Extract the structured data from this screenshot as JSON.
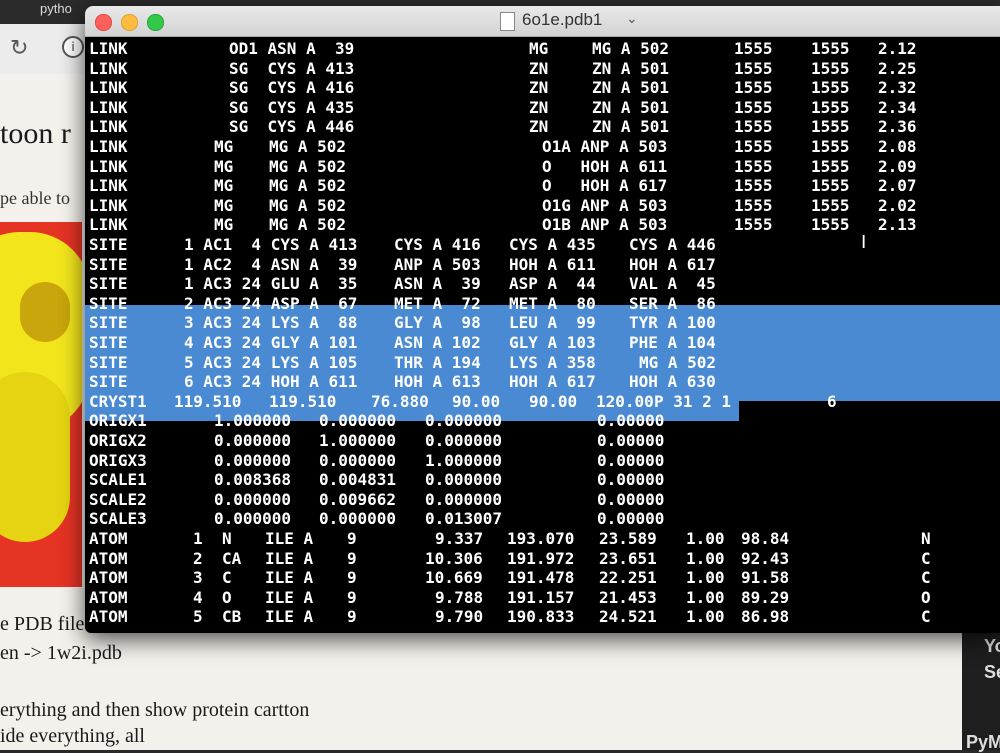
{
  "browser": {
    "tab_label": "pytho",
    "heading_fragment": "toon r",
    "text_lines": [
      "pe able to",
      "e PDB file",
      "en -> 1w2i.pdb",
      "erything and then show protein cartton",
      "ide everything, all"
    ],
    "side_panel_text": [
      "Yo",
      "Se",
      "PyM"
    ]
  },
  "terminal": {
    "title": "6o1e.pdb1",
    "accent_color": "#4a8ad2",
    "selected_rows": [
      12,
      13,
      14,
      15,
      16,
      17
    ],
    "records": [
      {
        "r": "LINK",
        "c": [
          [
            "OD1 ASN A  39",
            140
          ],
          [
            "MG",
            440
          ],
          [
            "MG A 502",
            503
          ],
          [
            "1555",
            645
          ],
          [
            "1555",
            722
          ],
          [
            "2.12",
            789
          ]
        ]
      },
      {
        "r": "LINK",
        "c": [
          [
            "SG  CYS A 413",
            140
          ],
          [
            "ZN",
            440
          ],
          [
            "ZN A 501",
            503
          ],
          [
            "1555",
            645
          ],
          [
            "1555",
            722
          ],
          [
            "2.25",
            789
          ]
        ]
      },
      {
        "r": "LINK",
        "c": [
          [
            "SG  CYS A 416",
            140
          ],
          [
            "ZN",
            440
          ],
          [
            "ZN A 501",
            503
          ],
          [
            "1555",
            645
          ],
          [
            "1555",
            722
          ],
          [
            "2.32",
            789
          ]
        ]
      },
      {
        "r": "LINK",
        "c": [
          [
            "SG  CYS A 435",
            140
          ],
          [
            "ZN",
            440
          ],
          [
            "ZN A 501",
            503
          ],
          [
            "1555",
            645
          ],
          [
            "1555",
            722
          ],
          [
            "2.34",
            789
          ]
        ]
      },
      {
        "r": "LINK",
        "c": [
          [
            "SG  CYS A 446",
            140
          ],
          [
            "ZN",
            440
          ],
          [
            "ZN A 501",
            503
          ],
          [
            "1555",
            645
          ],
          [
            "1555",
            722
          ],
          [
            "2.36",
            789
          ]
        ]
      },
      {
        "r": "LINK",
        "c": [
          [
            "MG",
            125
          ],
          [
            "MG A 502",
            180
          ],
          [
            "O1A ANP A 503",
            453
          ],
          [
            "1555",
            645
          ],
          [
            "1555",
            722
          ],
          [
            "2.08",
            789
          ]
        ]
      },
      {
        "r": "LINK",
        "c": [
          [
            "MG",
            125
          ],
          [
            "MG A 502",
            180
          ],
          [
            "O   HOH A 611",
            453
          ],
          [
            "1555",
            645
          ],
          [
            "1555",
            722
          ],
          [
            "2.09",
            789
          ]
        ]
      },
      {
        "r": "LINK",
        "c": [
          [
            "MG",
            125
          ],
          [
            "MG A 502",
            180
          ],
          [
            "O   HOH A 617",
            453
          ],
          [
            "1555",
            645
          ],
          [
            "1555",
            722
          ],
          [
            "2.07",
            789
          ]
        ]
      },
      {
        "r": "LINK",
        "c": [
          [
            "MG",
            125
          ],
          [
            "MG A 502",
            180
          ],
          [
            "O1G ANP A 503",
            453
          ],
          [
            "1555",
            645
          ],
          [
            "1555",
            722
          ],
          [
            "2.02",
            789
          ]
        ]
      },
      {
        "r": "LINK",
        "c": [
          [
            "MG",
            125
          ],
          [
            "MG A 502",
            180
          ],
          [
            "O1B ANP A 503",
            453
          ],
          [
            "1555",
            645
          ],
          [
            "1555",
            722
          ],
          [
            "2.13",
            789
          ]
        ]
      },
      {
        "r": "SITE",
        "c": [
          [
            "1 AC1  4 CYS A 413",
            95
          ],
          [
            "CYS A 416",
            305
          ],
          [
            "CYS A 435",
            420
          ],
          [
            "CYS A 446",
            540
          ]
        ]
      },
      {
        "r": "SITE",
        "c": [
          [
            "1 AC2  4 ASN A  39",
            95
          ],
          [
            "ANP A 503",
            305
          ],
          [
            "HOH A 611",
            420
          ],
          [
            "HOH A 617",
            540
          ]
        ]
      },
      {
        "r": "SITE",
        "c": [
          [
            "1 AC3 24 GLU A  35",
            95
          ],
          [
            "ASN A  39",
            305
          ],
          [
            "ASP A  44",
            420
          ],
          [
            "VAL A  45",
            540
          ]
        ]
      },
      {
        "r": "SITE",
        "c": [
          [
            "2 AC3 24 ASP A  67",
            95
          ],
          [
            "MET A  72",
            305
          ],
          [
            "MET A  80",
            420
          ],
          [
            "SER A  86",
            540
          ]
        ]
      },
      {
        "r": "SITE",
        "c": [
          [
            "3 AC3 24 LYS A  88",
            95
          ],
          [
            "GLY A  98",
            305
          ],
          [
            "LEU A  99",
            420
          ],
          [
            "TYR A 100",
            540
          ]
        ]
      },
      {
        "r": "SITE",
        "c": [
          [
            "4 AC3 24 GLY A 101",
            95
          ],
          [
            "ASN A 102",
            305
          ],
          [
            "GLY A 103",
            420
          ],
          [
            "PHE A 104",
            540
          ]
        ]
      },
      {
        "r": "SITE",
        "c": [
          [
            "5 AC3 24 LYS A 105",
            95
          ],
          [
            "THR A 194",
            305
          ],
          [
            "LYS A 358",
            420
          ],
          [
            "MG A 502",
            550
          ]
        ]
      },
      {
        "r": "SITE",
        "c": [
          [
            "6 AC3 24 HOH A 611",
            95
          ],
          [
            "HOH A 613",
            305
          ],
          [
            "HOH A 617",
            420
          ],
          [
            "HOH A 630",
            540
          ]
        ]
      },
      {
        "r": "CRYST1",
        "c": [
          [
            "119.510",
            85
          ],
          [
            "119.510",
            180
          ],
          [
            "76.880",
            282
          ],
          [
            "90.00",
            363
          ],
          [
            "90.00",
            440
          ],
          [
            "120.00",
            507
          ],
          [
            "P 31 2 1",
            565
          ],
          [
            "6",
            738
          ]
        ]
      },
      {
        "r": "ORIGX1",
        "c": [
          [
            "1.000000",
            125
          ],
          [
            "0.000000",
            230
          ],
          [
            "0.000000",
            336
          ],
          [
            "0.00000",
            508
          ]
        ]
      },
      {
        "r": "ORIGX2",
        "c": [
          [
            "0.000000",
            125
          ],
          [
            "1.000000",
            230
          ],
          [
            "0.000000",
            336
          ],
          [
            "0.00000",
            508
          ]
        ]
      },
      {
        "r": "ORIGX3",
        "c": [
          [
            "0.000000",
            125
          ],
          [
            "0.000000",
            230
          ],
          [
            "1.000000",
            336
          ],
          [
            "0.00000",
            508
          ]
        ]
      },
      {
        "r": "SCALE1",
        "c": [
          [
            "0.008368",
            125
          ],
          [
            "0.004831",
            230
          ],
          [
            "0.000000",
            336
          ],
          [
            "0.00000",
            508
          ]
        ]
      },
      {
        "r": "SCALE2",
        "c": [
          [
            "0.000000",
            125
          ],
          [
            "0.009662",
            230
          ],
          [
            "0.000000",
            336
          ],
          [
            "0.00000",
            508
          ]
        ]
      },
      {
        "r": "SCALE3",
        "c": [
          [
            "0.000000",
            125
          ],
          [
            "0.000000",
            230
          ],
          [
            "0.013007",
            336
          ],
          [
            "0.00000",
            508
          ]
        ]
      },
      {
        "r": "ATOM",
        "c": [
          [
            "1",
            104
          ],
          [
            "N",
            133
          ],
          [
            "ILE A",
            176
          ],
          [
            "9",
            258
          ],
          [
            "9.337",
            346
          ],
          [
            "193.070",
            418
          ],
          [
            "23.589",
            510
          ],
          [
            "1.00",
            597
          ],
          [
            "98.84",
            652
          ],
          [
            "N",
            832
          ]
        ]
      },
      {
        "r": "ATOM",
        "c": [
          [
            "2",
            104
          ],
          [
            "CA",
            133
          ],
          [
            "ILE A",
            176
          ],
          [
            "9",
            258
          ],
          [
            "10.306",
            336
          ],
          [
            "191.972",
            418
          ],
          [
            "23.651",
            510
          ],
          [
            "1.00",
            597
          ],
          [
            "92.43",
            652
          ],
          [
            "C",
            832
          ]
        ]
      },
      {
        "r": "ATOM",
        "c": [
          [
            "3",
            104
          ],
          [
            "C",
            133
          ],
          [
            "ILE A",
            176
          ],
          [
            "9",
            258
          ],
          [
            "10.669",
            336
          ],
          [
            "191.478",
            418
          ],
          [
            "22.251",
            510
          ],
          [
            "1.00",
            597
          ],
          [
            "91.58",
            652
          ],
          [
            "C",
            832
          ]
        ]
      },
      {
        "r": "ATOM",
        "c": [
          [
            "4",
            104
          ],
          [
            "O",
            133
          ],
          [
            "ILE A",
            176
          ],
          [
            "9",
            258
          ],
          [
            "9.788",
            346
          ],
          [
            "191.157",
            418
          ],
          [
            "21.453",
            510
          ],
          [
            "1.00",
            597
          ],
          [
            "89.29",
            652
          ],
          [
            "O",
            832
          ]
        ]
      },
      {
        "r": "ATOM",
        "c": [
          [
            "5",
            104
          ],
          [
            "CB",
            133
          ],
          [
            "ILE A",
            176
          ],
          [
            "9",
            258
          ],
          [
            "9.790",
            346
          ],
          [
            "190.833",
            418
          ],
          [
            "24.521",
            510
          ],
          [
            "1.00",
            597
          ],
          [
            "86.98",
            652
          ],
          [
            "C",
            832
          ]
        ]
      }
    ]
  }
}
